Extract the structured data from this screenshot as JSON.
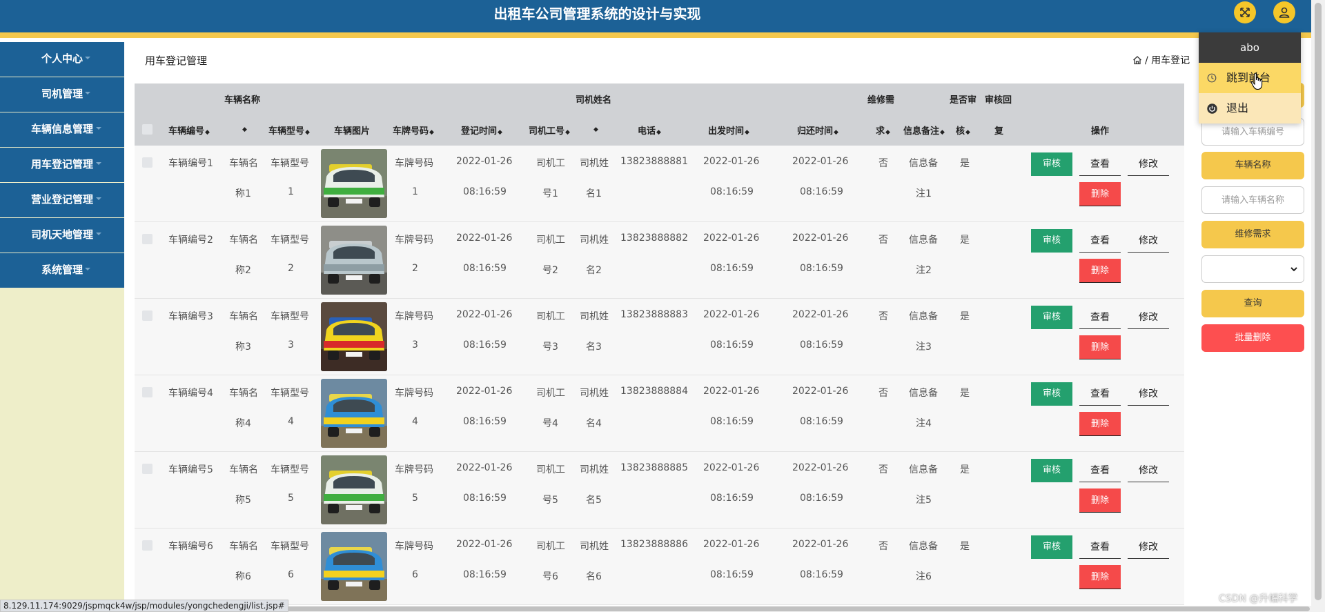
{
  "header": {
    "title": "出租车公司管理系统的设计与实现"
  },
  "sidebar": {
    "items": [
      {
        "label": "个人中心"
      },
      {
        "label": "司机管理"
      },
      {
        "label": "车辆信息管理"
      },
      {
        "label": "用车登记管理"
      },
      {
        "label": "营业登记管理"
      },
      {
        "label": "司机天地管理"
      },
      {
        "label": "系统管理"
      }
    ]
  },
  "page": {
    "title": "用车登记管理",
    "breadcrumb": "/ 用车登记"
  },
  "table": {
    "top_headers": {
      "vehicle_name": "车辆名称",
      "driver_name": "司机姓名",
      "repair_need": "维修需",
      "is_audited": "是否审",
      "audit_reply": "审核回"
    },
    "headers": {
      "vehicle_no": "车辆编号",
      "vehicle_type": "车辆型号",
      "vehicle_image": "车辆图片",
      "plate_no": "车牌号码",
      "register_time": "登记时间",
      "driver_id": "司机工号",
      "phone": "电话",
      "depart_time": "出发时间",
      "return_time": "归还时间",
      "repair_need_2": "求",
      "note": "信息备注",
      "audited_2": "核",
      "reply_2": "复",
      "actions": "操作"
    },
    "sort_glyph": "◆",
    "rows": [
      {
        "vehicle_no": "车辆编号1",
        "name_1": "车辆名",
        "name_2": "称1",
        "type_1": "车辆型号",
        "type_2": "1",
        "plate_1": "车牌号码",
        "plate_2": "1",
        "reg_date": "2022-01-26",
        "reg_time": "08:16:59",
        "driver_id_1": "司机工",
        "driver_id_2": "号1",
        "driver_name_1": "司机姓",
        "driver_name_2": "名1",
        "phone": "13823888881",
        "dep_date": "2022-01-26",
        "dep_time": "08:16:59",
        "ret_date": "2022-01-26",
        "ret_time": "08:16:59",
        "repair": "否",
        "note_1": "信息备",
        "note_2": "注1",
        "audited": "是"
      },
      {
        "vehicle_no": "车辆编号2",
        "name_1": "车辆名",
        "name_2": "称2",
        "type_1": "车辆型号",
        "type_2": "2",
        "plate_1": "车牌号码",
        "plate_2": "2",
        "reg_date": "2022-01-26",
        "reg_time": "08:16:59",
        "driver_id_1": "司机工",
        "driver_id_2": "号2",
        "driver_name_1": "司机姓",
        "driver_name_2": "名2",
        "phone": "13823888882",
        "dep_date": "2022-01-26",
        "dep_time": "08:16:59",
        "ret_date": "2022-01-26",
        "ret_time": "08:16:59",
        "repair": "否",
        "note_1": "信息备",
        "note_2": "注2",
        "audited": "是"
      },
      {
        "vehicle_no": "车辆编号3",
        "name_1": "车辆名",
        "name_2": "称3",
        "type_1": "车辆型号",
        "type_2": "3",
        "plate_1": "车牌号码",
        "plate_2": "3",
        "reg_date": "2022-01-26",
        "reg_time": "08:16:59",
        "driver_id_1": "司机工",
        "driver_id_2": "号3",
        "driver_name_1": "司机姓",
        "driver_name_2": "名3",
        "phone": "13823888883",
        "dep_date": "2022-01-26",
        "dep_time": "08:16:59",
        "ret_date": "2022-01-26",
        "ret_time": "08:16:59",
        "repair": "否",
        "note_1": "信息备",
        "note_2": "注3",
        "audited": "是"
      },
      {
        "vehicle_no": "车辆编号4",
        "name_1": "车辆名",
        "name_2": "称4",
        "type_1": "车辆型号",
        "type_2": "4",
        "plate_1": "车牌号码",
        "plate_2": "4",
        "reg_date": "2022-01-26",
        "reg_time": "08:16:59",
        "driver_id_1": "司机工",
        "driver_id_2": "号4",
        "driver_name_1": "司机姓",
        "driver_name_2": "名4",
        "phone": "13823888884",
        "dep_date": "2022-01-26",
        "dep_time": "08:16:59",
        "ret_date": "2022-01-26",
        "ret_time": "08:16:59",
        "repair": "否",
        "note_1": "信息备",
        "note_2": "注4",
        "audited": "是"
      },
      {
        "vehicle_no": "车辆编号5",
        "name_1": "车辆名",
        "name_2": "称5",
        "type_1": "车辆型号",
        "type_2": "5",
        "plate_1": "车牌号码",
        "plate_2": "5",
        "reg_date": "2022-01-26",
        "reg_time": "08:16:59",
        "driver_id_1": "司机工",
        "driver_id_2": "号5",
        "driver_name_1": "司机姓",
        "driver_name_2": "名5",
        "phone": "13823888885",
        "dep_date": "2022-01-26",
        "dep_time": "08:16:59",
        "ret_date": "2022-01-26",
        "ret_time": "08:16:59",
        "repair": "否",
        "note_1": "信息备",
        "note_2": "注5",
        "audited": "是"
      },
      {
        "vehicle_no": "车辆编号6",
        "name_1": "车辆名",
        "name_2": "称6",
        "type_1": "车辆型号",
        "type_2": "6",
        "plate_1": "车牌号码",
        "plate_2": "6",
        "reg_date": "2022-01-26",
        "reg_time": "08:16:59",
        "driver_id_1": "司机工",
        "driver_id_2": "号6",
        "driver_name_1": "司机姓",
        "driver_name_2": "名6",
        "phone": "13823888886",
        "dep_date": "2022-01-26",
        "dep_time": "08:16:59",
        "ret_date": "2022-01-26",
        "ret_time": "08:16:59",
        "repair": "否",
        "note_1": "信息备",
        "note_2": "注6",
        "audited": "是"
      }
    ],
    "actions": {
      "audit": "审核",
      "view": "查看",
      "edit": "修改",
      "delete": "删除"
    }
  },
  "search_panel": {
    "vehicle_no_placeholder": "请输入车辆编号",
    "vehicle_name_label": "车辆名称",
    "vehicle_name_placeholder": "请输入车辆名称",
    "repair_need_label": "维修需求",
    "repair_need_selected": "",
    "query_button": "查询",
    "batch_delete_button": "批量删除"
  },
  "user_menu": {
    "username": "abo",
    "goto_front": "跳到前台",
    "logout": "退出"
  },
  "status_bar": {
    "url": "8.129.11.174:9029/jspmqck4w/jsp/modules/yongchedengji/list.jsp#"
  },
  "watermark": "CSDN @升幅科学",
  "colors": {
    "header": "#1c6196",
    "accent_yellow": "#f5c84c",
    "audit_green": "#24a06e",
    "delete_red": "#f54a4a",
    "sidebar_bg": "#eeeec9"
  },
  "icons": {
    "fullscreen": "expand-arrows-icon",
    "user": "user-icon",
    "home": "home-icon",
    "goto_front": "clock-icon",
    "logout": "power-icon"
  }
}
